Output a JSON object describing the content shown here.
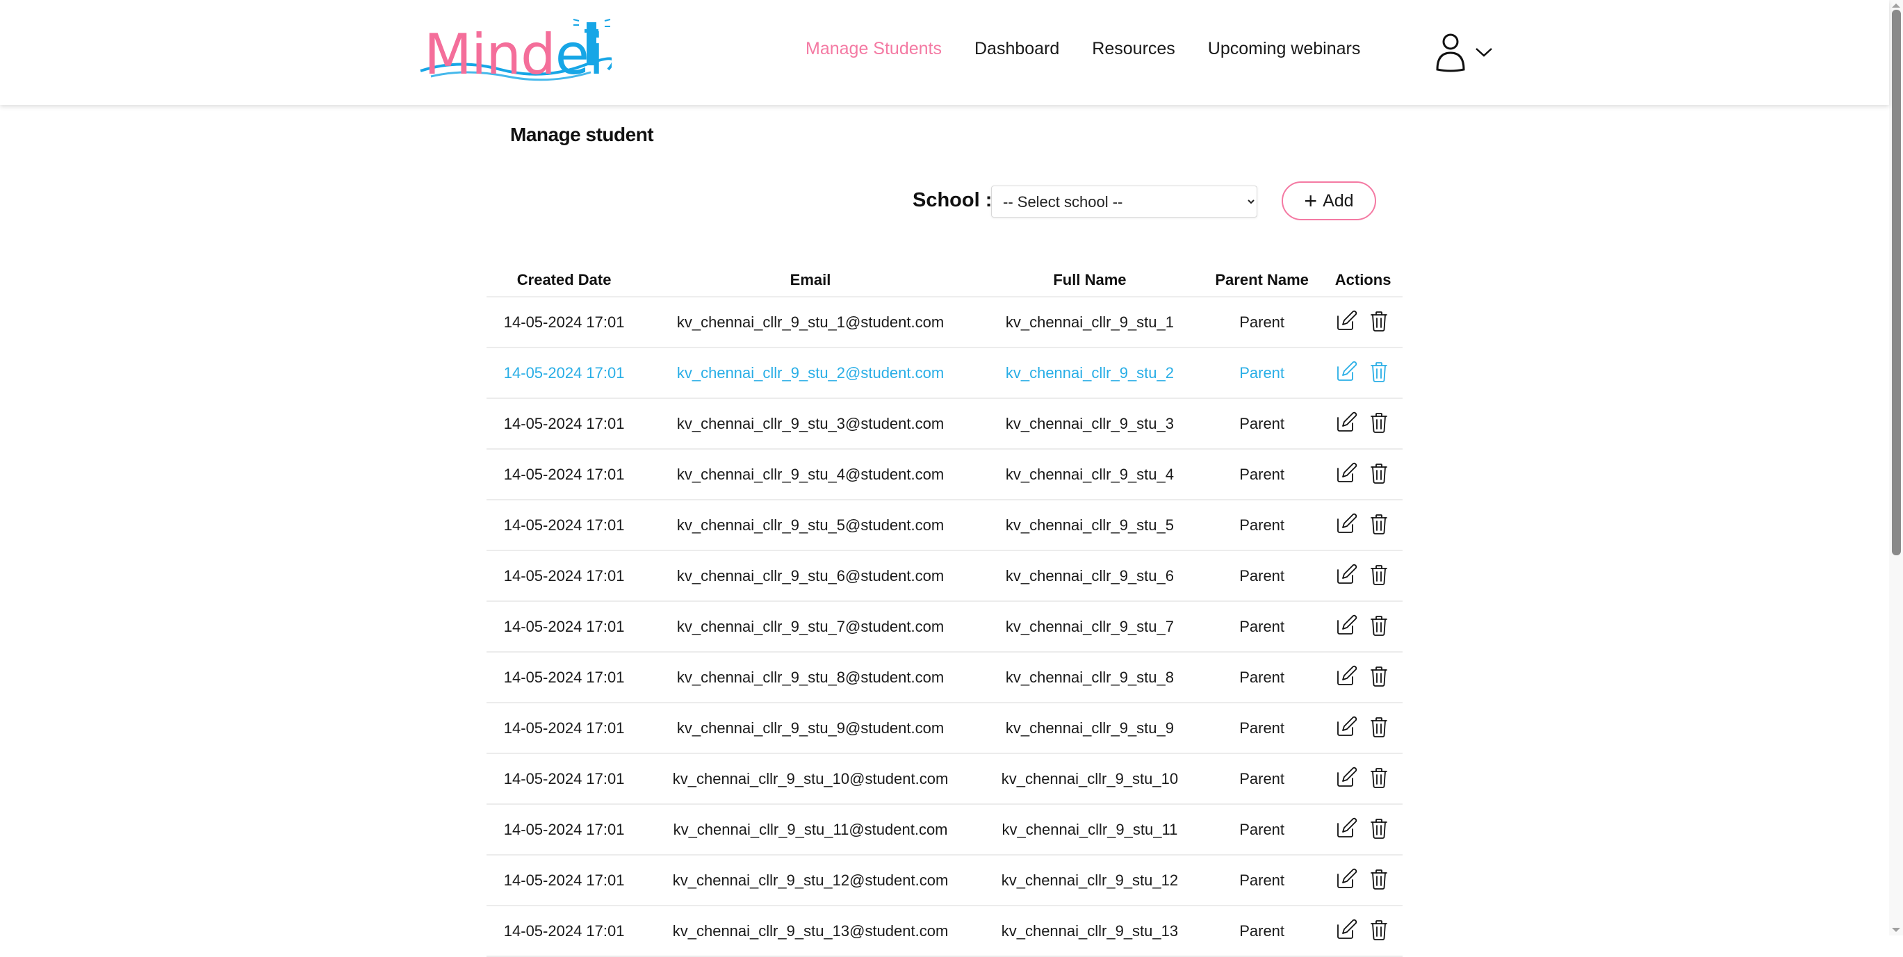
{
  "header": {
    "logo_part1": "Mind",
    "logo_part2": "ei",
    "nav": [
      {
        "label": "Manage Students",
        "active": true
      },
      {
        "label": "Dashboard",
        "active": false
      },
      {
        "label": "Resources",
        "active": false
      },
      {
        "label": "Upcoming webinars",
        "active": false
      }
    ],
    "user_icon": "user-icon",
    "dropdown_icon": "chevron-down-icon"
  },
  "colors": {
    "brand_pink": "#f47aa3",
    "brand_blue": "#17a6e6",
    "hover_row": "#29aee6"
  },
  "page": {
    "title": "Manage student",
    "school_label": "School :",
    "school_select": {
      "selected": "-- Select school --"
    },
    "add_label": "Add"
  },
  "table": {
    "columns": [
      "Created Date",
      "Email",
      "Full Name",
      "Parent Name",
      "Actions"
    ],
    "rows": [
      {
        "date": "14-05-2024 17:01",
        "email": "kv_chennai_cllr_9_stu_1@student.com",
        "name": "kv_chennai_cllr_9_stu_1",
        "parent": "Parent"
      },
      {
        "date": "14-05-2024 17:01",
        "email": "kv_chennai_cllr_9_stu_2@student.com",
        "name": "kv_chennai_cllr_9_stu_2",
        "parent": "Parent",
        "hover": true
      },
      {
        "date": "14-05-2024 17:01",
        "email": "kv_chennai_cllr_9_stu_3@student.com",
        "name": "kv_chennai_cllr_9_stu_3",
        "parent": "Parent"
      },
      {
        "date": "14-05-2024 17:01",
        "email": "kv_chennai_cllr_9_stu_4@student.com",
        "name": "kv_chennai_cllr_9_stu_4",
        "parent": "Parent"
      },
      {
        "date": "14-05-2024 17:01",
        "email": "kv_chennai_cllr_9_stu_5@student.com",
        "name": "kv_chennai_cllr_9_stu_5",
        "parent": "Parent"
      },
      {
        "date": "14-05-2024 17:01",
        "email": "kv_chennai_cllr_9_stu_6@student.com",
        "name": "kv_chennai_cllr_9_stu_6",
        "parent": "Parent"
      },
      {
        "date": "14-05-2024 17:01",
        "email": "kv_chennai_cllr_9_stu_7@student.com",
        "name": "kv_chennai_cllr_9_stu_7",
        "parent": "Parent"
      },
      {
        "date": "14-05-2024 17:01",
        "email": "kv_chennai_cllr_9_stu_8@student.com",
        "name": "kv_chennai_cllr_9_stu_8",
        "parent": "Parent"
      },
      {
        "date": "14-05-2024 17:01",
        "email": "kv_chennai_cllr_9_stu_9@student.com",
        "name": "kv_chennai_cllr_9_stu_9",
        "parent": "Parent"
      },
      {
        "date": "14-05-2024 17:01",
        "email": "kv_chennai_cllr_9_stu_10@student.com",
        "name": "kv_chennai_cllr_9_stu_10",
        "parent": "Parent"
      },
      {
        "date": "14-05-2024 17:01",
        "email": "kv_chennai_cllr_9_stu_11@student.com",
        "name": "kv_chennai_cllr_9_stu_11",
        "parent": "Parent"
      },
      {
        "date": "14-05-2024 17:01",
        "email": "kv_chennai_cllr_9_stu_12@student.com",
        "name": "kv_chennai_cllr_9_stu_12",
        "parent": "Parent"
      },
      {
        "date": "14-05-2024 17:01",
        "email": "kv_chennai_cllr_9_stu_13@student.com",
        "name": "kv_chennai_cllr_9_stu_13",
        "parent": "Parent"
      }
    ],
    "row_actions": [
      "edit-icon",
      "trash-icon"
    ]
  }
}
